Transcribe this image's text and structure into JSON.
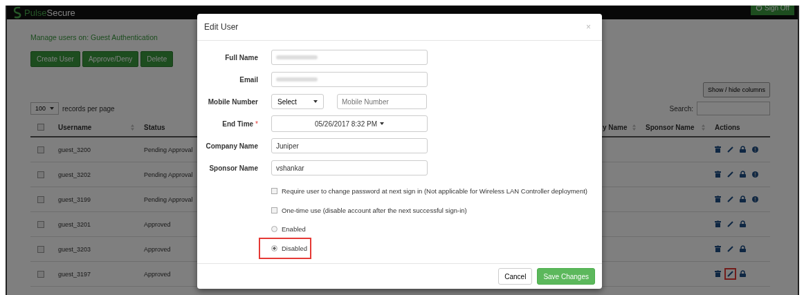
{
  "header": {
    "brand_first": "Pulse",
    "brand_second": "Secure",
    "sign_off": "Sign Off"
  },
  "page": {
    "title": "Manage users on: Guest Authentication",
    "actions": [
      "Create User",
      "Approve/Deny",
      "Delete"
    ],
    "columns_button": "Show / hide columns",
    "page_size": "100",
    "page_size_label": "records per page",
    "search_label": "Search:"
  },
  "table": {
    "select_all_checked": false,
    "columns": [
      {
        "label": "Username",
        "sortable": true
      },
      {
        "label": "Status",
        "sortable": false
      },
      {
        "label": "y Name",
        "sortable": true
      },
      {
        "label": "Sponsor Name",
        "sortable": true
      },
      {
        "label": "Actions",
        "sortable": false
      }
    ],
    "rows": [
      {
        "checked": false,
        "username": "guest_3200",
        "status": "Pending Approval",
        "actions": [
          {
            "kind": "delete",
            "highlighted": false
          },
          {
            "kind": "edit",
            "highlighted": false
          },
          {
            "kind": "lock",
            "highlighted": false
          },
          {
            "kind": "approve",
            "highlighted": false
          }
        ]
      },
      {
        "checked": false,
        "username": "guest_3202",
        "status": "Pending Approval",
        "actions": [
          {
            "kind": "delete",
            "highlighted": false
          },
          {
            "kind": "edit",
            "highlighted": false
          },
          {
            "kind": "lock",
            "highlighted": false
          },
          {
            "kind": "approve",
            "highlighted": false
          }
        ]
      },
      {
        "checked": false,
        "username": "guest_3199",
        "status": "Pending Approval",
        "actions": [
          {
            "kind": "delete",
            "highlighted": false
          },
          {
            "kind": "edit",
            "highlighted": false
          },
          {
            "kind": "lock",
            "highlighted": false
          },
          {
            "kind": "approve",
            "highlighted": false
          }
        ]
      },
      {
        "checked": false,
        "username": "guest_3201",
        "status": "Approved",
        "actions": [
          {
            "kind": "delete",
            "highlighted": false
          },
          {
            "kind": "edit",
            "highlighted": false
          },
          {
            "kind": "lock",
            "highlighted": false
          }
        ]
      },
      {
        "checked": false,
        "username": "guest_3203",
        "status": "Approved",
        "actions": [
          {
            "kind": "delete",
            "highlighted": false
          },
          {
            "kind": "edit",
            "highlighted": false
          },
          {
            "kind": "lock",
            "highlighted": false
          }
        ]
      },
      {
        "checked": false,
        "username": "guest_3197",
        "status": "Approved",
        "actions": [
          {
            "kind": "delete",
            "highlighted": false
          },
          {
            "kind": "edit",
            "highlighted": true
          },
          {
            "kind": "lock",
            "highlighted": false
          }
        ]
      }
    ]
  },
  "dialog": {
    "title": "Edit User",
    "close": "×",
    "required_mark": "*",
    "fields": [
      {
        "kind": "text",
        "label": "Full Name",
        "required": false,
        "redacted": true
      },
      {
        "kind": "text",
        "label": "Email",
        "required": false,
        "redacted": true
      },
      {
        "kind": "phone",
        "label": "Mobile Number",
        "required": false,
        "select": "Select",
        "placeholder": "Mobile Number"
      },
      {
        "kind": "datetime",
        "label": "End Time",
        "required": true,
        "value": "05/26/2017 8:32 PM"
      },
      {
        "kind": "text",
        "label": "Company Name",
        "required": false,
        "redacted": false,
        "value": "Juniper"
      },
      {
        "kind": "text",
        "label": "Sponsor Name",
        "required": false,
        "redacted": false,
        "value": "vshankar"
      }
    ],
    "options": [
      {
        "kind": "checkbox",
        "label": "Require user to change password at next sign in (Not applicable for Wireless LAN Controller deployment)",
        "checked": false,
        "highlighted": false
      },
      {
        "kind": "checkbox",
        "label": "One-time use (disable account after the next successful sign-in)",
        "checked": false,
        "highlighted": false
      },
      {
        "kind": "radio",
        "label": "Enabled",
        "selected": false,
        "highlighted": false
      },
      {
        "kind": "radio",
        "label": "Disabled",
        "selected": true,
        "highlighted": true
      }
    ],
    "buttons": [
      {
        "label": "Cancel",
        "primary": false
      },
      {
        "label": "Save Changes",
        "primary": true
      }
    ]
  }
}
